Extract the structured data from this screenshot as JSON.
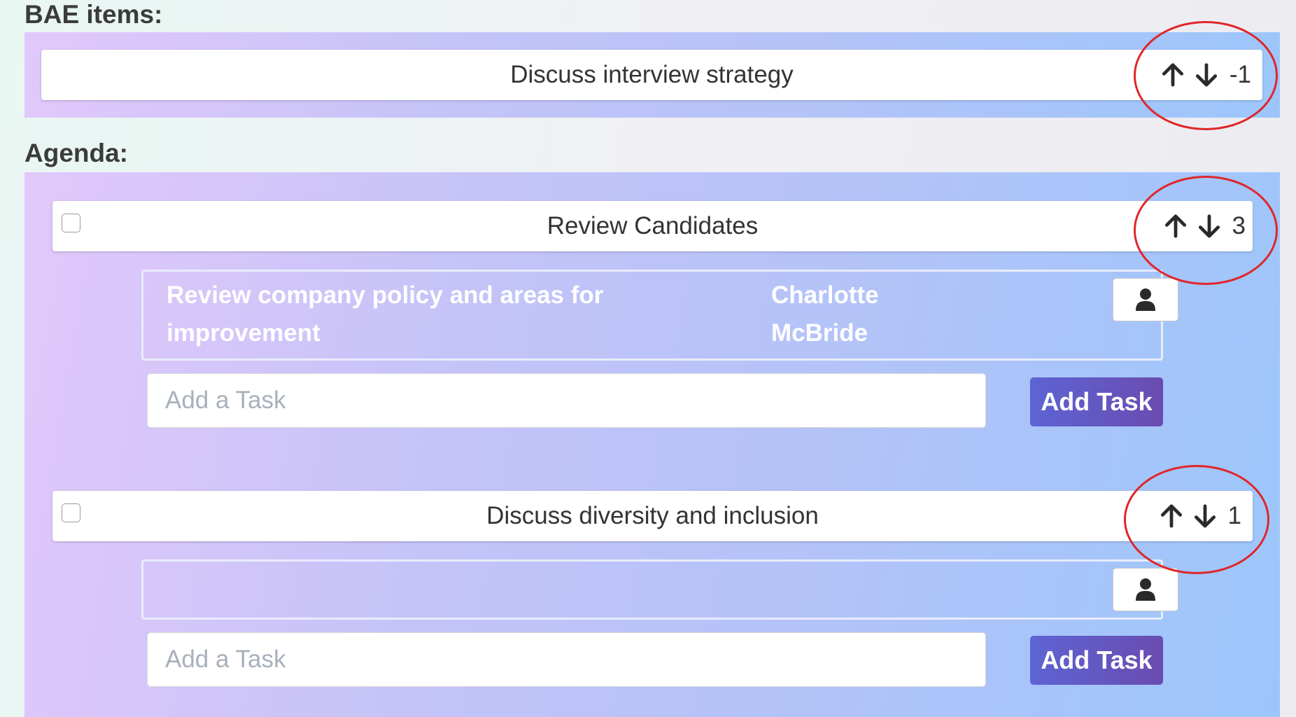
{
  "bae_section": {
    "label": "BAE items:",
    "items": [
      {
        "title": "Discuss interview strategy",
        "score": "-1"
      }
    ]
  },
  "agenda_section": {
    "label": "Agenda:",
    "items": [
      {
        "title": "Review Candidates",
        "score": "3",
        "checked": false,
        "task": {
          "line1": "Review company policy and areas for",
          "line2": "improvement",
          "assignee_line1": "Charlotte",
          "assignee_line2": "McBride"
        },
        "input_placeholder": "Add a Task",
        "add_button_label": "Add Task"
      },
      {
        "title": "Discuss diversity and inclusion",
        "score": "1",
        "checked": false,
        "task": {
          "line1": "",
          "line2": "",
          "assignee_line1": "",
          "assignee_line2": ""
        },
        "input_placeholder": "Add a Task",
        "add_button_label": "Add Task"
      }
    ]
  },
  "icons": [
    "arrow-up-icon",
    "arrow-down-icon",
    "user-icon"
  ],
  "colors": {
    "annotation_circle": "#e0262a",
    "add_button": "#5d64d4",
    "panel_start": "#e2c8fa",
    "panel_end": "#9cc6fb"
  }
}
